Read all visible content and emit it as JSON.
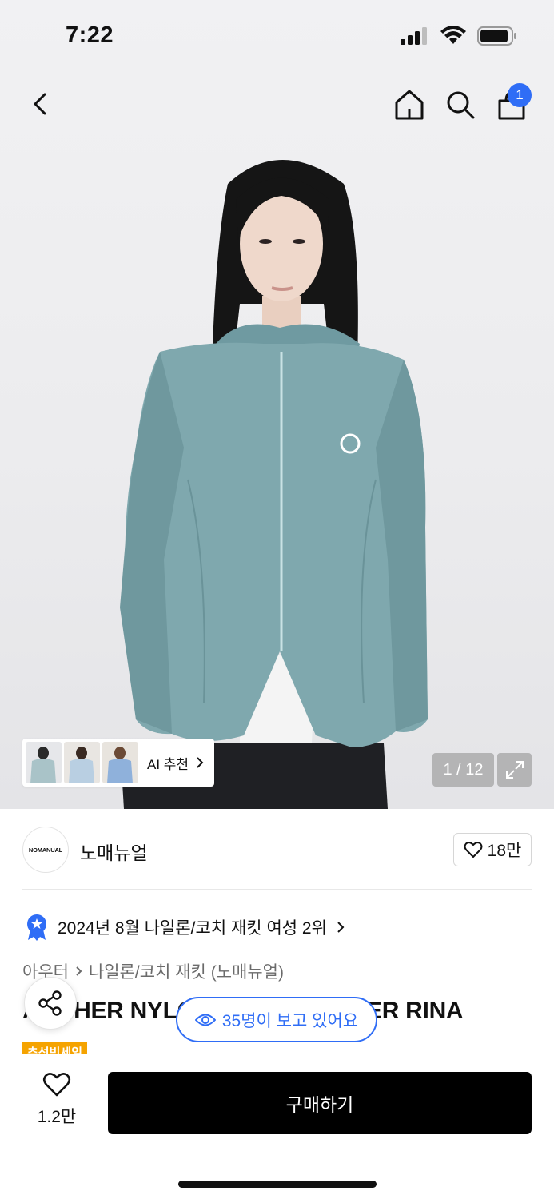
{
  "status_bar": {
    "time": "7:22"
  },
  "nav": {
    "cart_count": "1"
  },
  "gallery": {
    "ai_label": "AI 추천",
    "counter": "1 / 12"
  },
  "brand": {
    "logo_text": "NOMANUAL",
    "name": "노매뉴얼",
    "likes": "18만"
  },
  "ranking": {
    "text": "2024년 8월 나일론/코치 재킷 여성 2위"
  },
  "breadcrumb": {
    "level1": "아우터",
    "level2": "나일론/코치 재킷 (노매뉴얼)"
  },
  "product": {
    "title": "ARCHER NYLON WINDBREAKER RINA",
    "sale_tag": "추석빅세일"
  },
  "viewers": {
    "text": "35명이 보고 있어요"
  },
  "bottom": {
    "wish_count": "1.2만",
    "buy_label": "구매하기"
  },
  "colors": {
    "accent": "#2f6df6",
    "jacket": "#7fa8ae",
    "sale": "#f5a300"
  }
}
